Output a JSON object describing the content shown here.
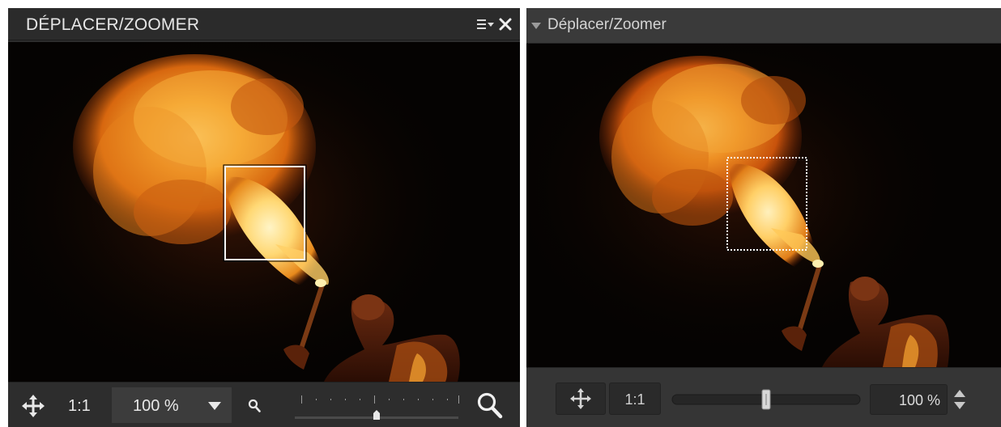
{
  "left_panel": {
    "title": "DÉPLACER/ZOOMER",
    "menu_icon": "panel-menu-icon",
    "close_icon": "close-icon",
    "toolbar": {
      "move_icon": "move-icon",
      "one_to_one_label": "1:1",
      "zoom_value": "100 %",
      "zoom_dropdown_icon": "caret-down-icon",
      "zoom_out_icon": "magnifier-small-icon",
      "zoom_in_icon": "magnifier-large-icon",
      "slider_level": 0.5
    }
  },
  "right_panel": {
    "title": "Déplacer/Zoomer",
    "collapse_icon": "triangle-down-icon",
    "toolbar": {
      "move_icon": "move-icon",
      "one_to_one_label": "1:1",
      "zoom_value": "100 %",
      "stepper_icon": "up-down-stepper-icon",
      "slider_level": 0.5
    }
  },
  "colors": {
    "panel_bg": "#2d2d2d",
    "header_text": "#e6e6e6",
    "flame_core": "#ffe9a0",
    "flame_mid": "#f29a24",
    "flame_edge": "#9a2d05",
    "image_bg": "#050302"
  }
}
